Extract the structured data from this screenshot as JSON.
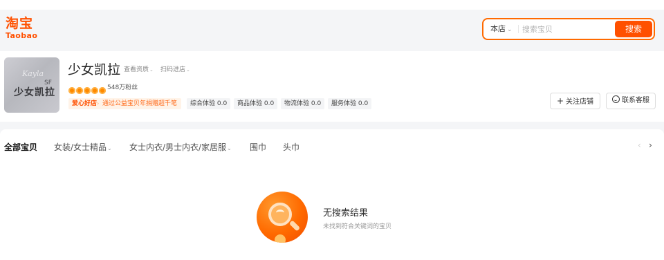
{
  "header": {
    "logo_cn": "淘宝",
    "logo_en": "Taobao",
    "search": {
      "scope": "本店",
      "placeholder": "搜索宝贝",
      "button": "搜索"
    }
  },
  "shop": {
    "name": "少女凯拉",
    "avatar": {
      "script": "Kayla",
      "name": "少女凯拉",
      "mark": "SF"
    },
    "links": {
      "credentials": "查看资质",
      "qr": "扫码进店"
    },
    "fans": "548万粉丝",
    "charity": {
      "tag": "爱心好店",
      "text": "通过公益宝贝年捐赠超千笔"
    },
    "metrics": [
      {
        "label": "综合体验 0.0"
      },
      {
        "label": "商品体验 0.0"
      },
      {
        "label": "物流体验 0.0"
      },
      {
        "label": "服务体验 0.0"
      }
    ],
    "follow_button": "关注店铺",
    "service_button": "联系客服"
  },
  "categories": [
    {
      "label": "全部宝贝",
      "active": true
    },
    {
      "label": "女装/女士精品",
      "dropdown": true
    },
    {
      "label": "女士内衣/男士内衣/家居服",
      "dropdown": true
    },
    {
      "label": "围巾"
    },
    {
      "label": "头巾"
    }
  ],
  "empty": {
    "title": "无搜索结果",
    "subtitle": "未找到符合关键词的宝贝"
  },
  "colors": {
    "brand": "#ff5000",
    "accent": "#ff6a00",
    "page_bg": "#f4f5f7"
  },
  "icons": [
    "chevron-down-icon",
    "plus-icon",
    "smile-icon",
    "chevron-left-icon",
    "chevron-right-icon",
    "search-illustration"
  ]
}
